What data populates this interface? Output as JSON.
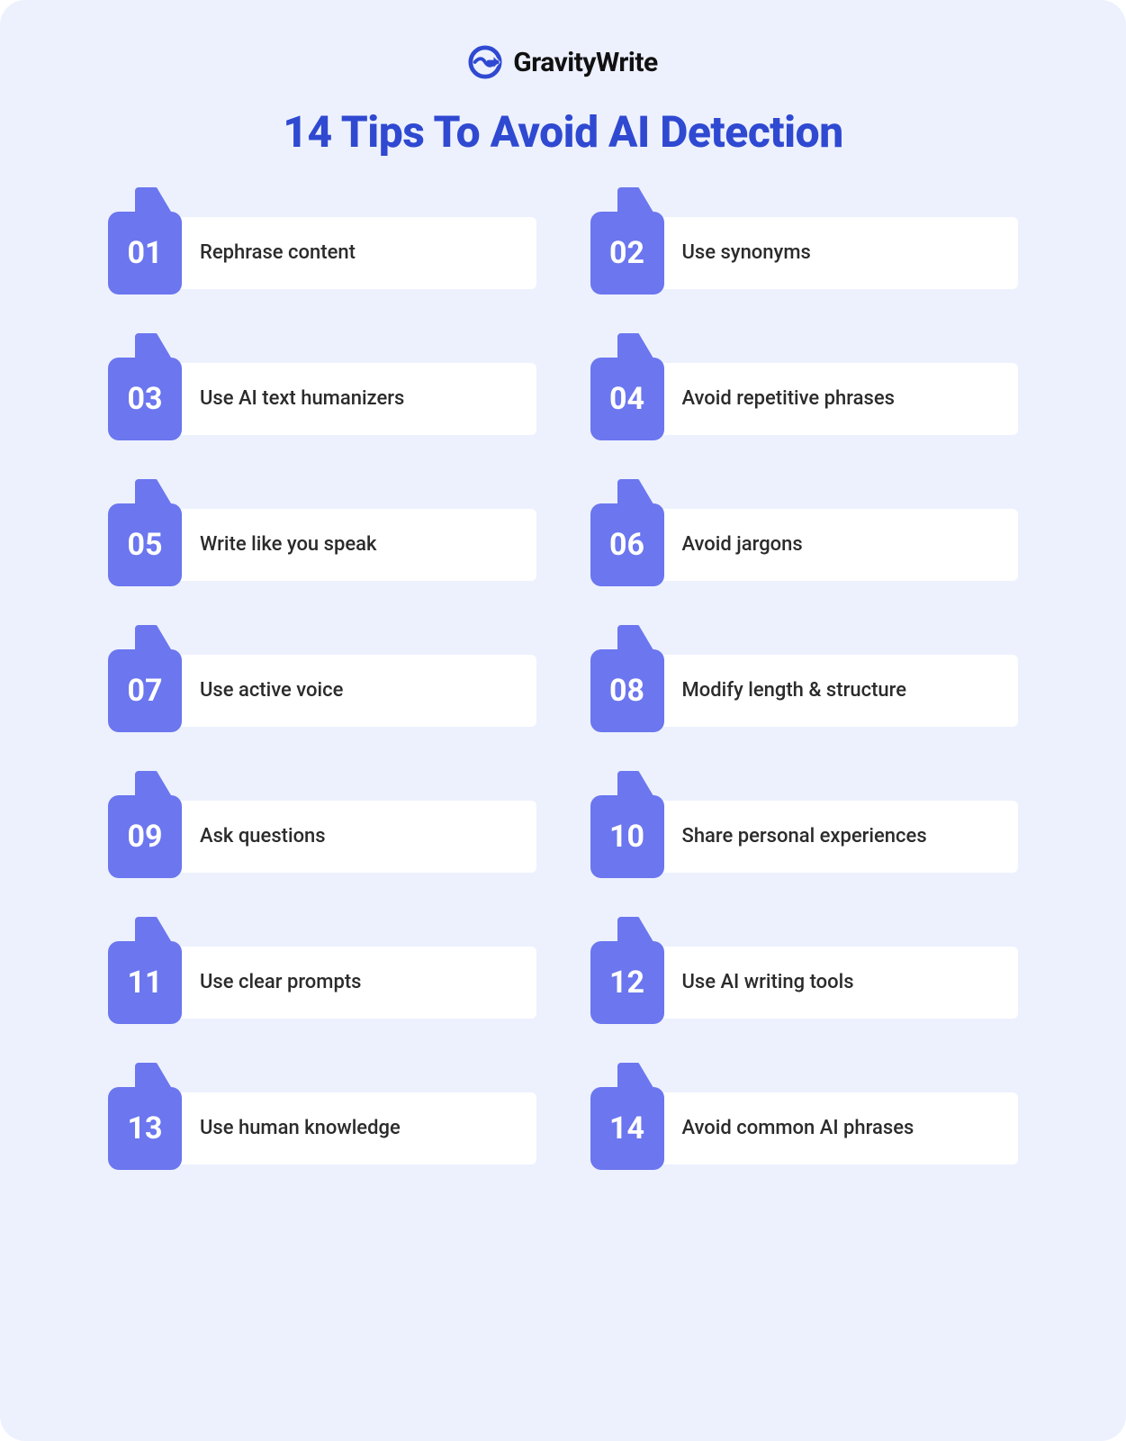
{
  "brand": {
    "name": "GravityWrite",
    "icon_color": "#2f49d1"
  },
  "title": "14 Tips To Avoid AI Detection",
  "colors": {
    "page_bg": "#edf1fe",
    "title": "#2f49d1",
    "badge": "#6b76ef",
    "card_bg": "#ffffff",
    "text": "#2b2b2b"
  },
  "tips": [
    {
      "num": "01",
      "text": "Rephrase content"
    },
    {
      "num": "02",
      "text": "Use synonyms"
    },
    {
      "num": "03",
      "text": "Use AI text humanizers"
    },
    {
      "num": "04",
      "text": "Avoid repetitive phrases"
    },
    {
      "num": "05",
      "text": "Write like you speak"
    },
    {
      "num": "06",
      "text": "Avoid jargons"
    },
    {
      "num": "07",
      "text": "Use active voice"
    },
    {
      "num": "08",
      "text": "Modify length & structure"
    },
    {
      "num": "09",
      "text": "Ask questions"
    },
    {
      "num": "10",
      "text": "Share personal experiences"
    },
    {
      "num": "11",
      "text": "Use clear prompts"
    },
    {
      "num": "12",
      "text": "Use AI writing tools"
    },
    {
      "num": "13",
      "text": "Use human knowledge"
    },
    {
      "num": "14",
      "text": "Avoid common AI phrases"
    }
  ]
}
